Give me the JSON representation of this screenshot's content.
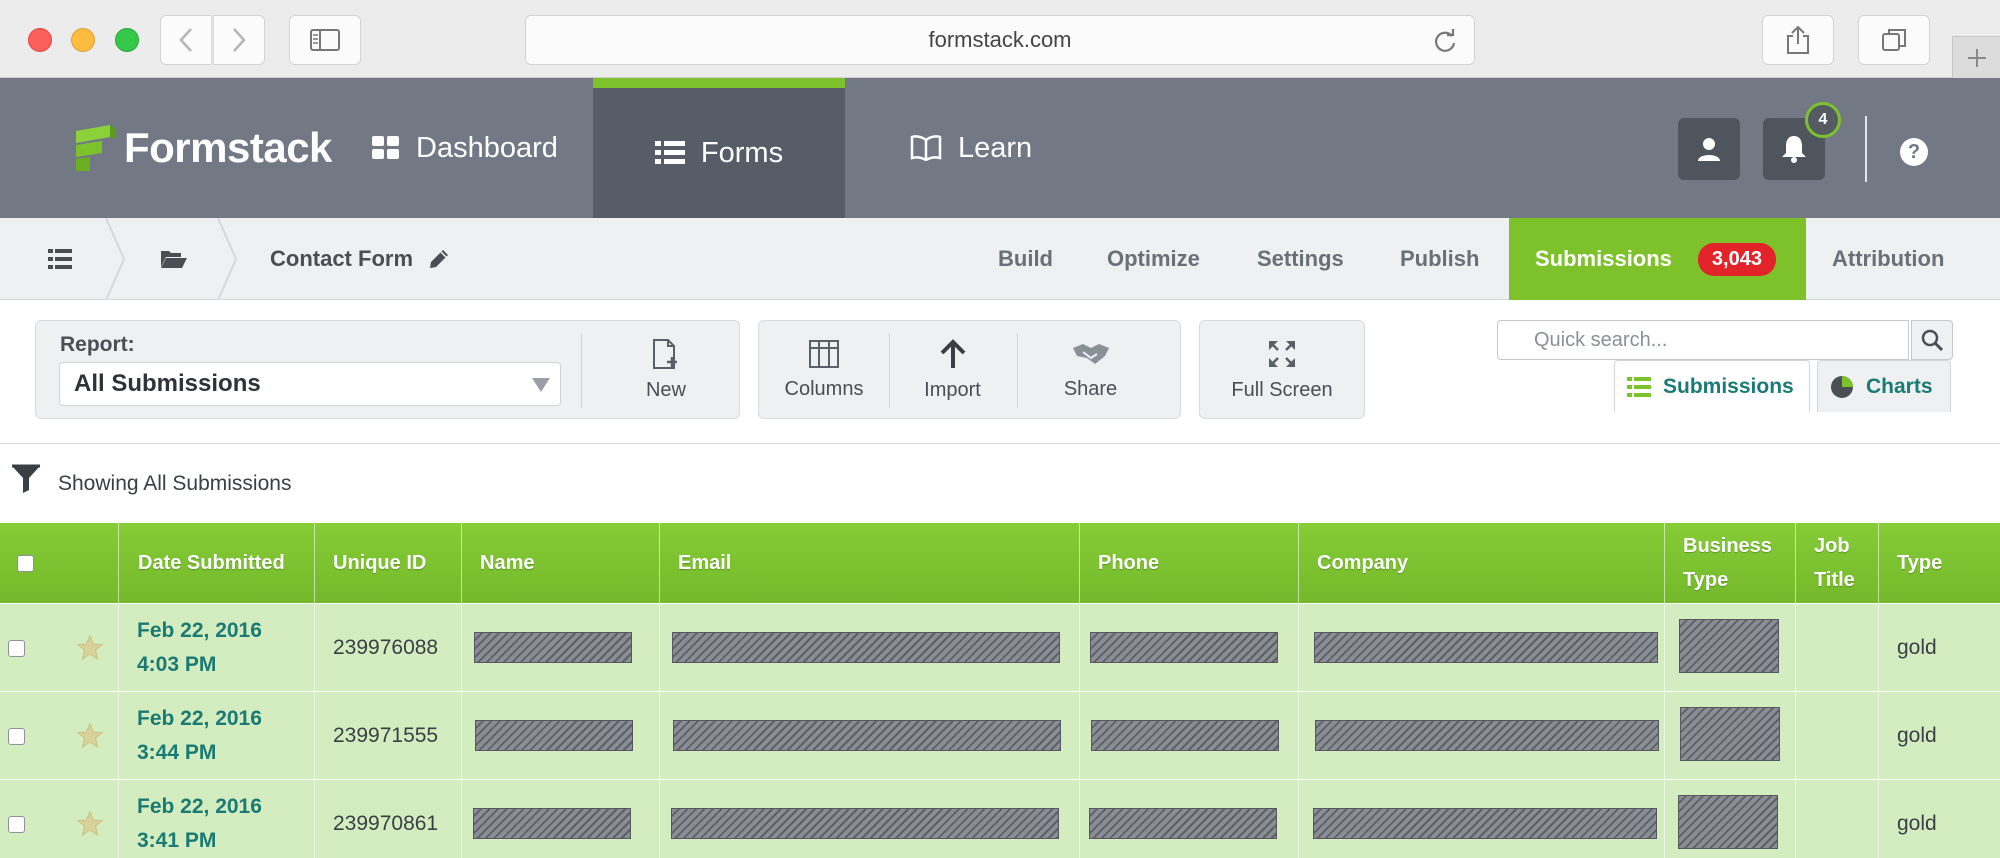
{
  "browser": {
    "url": "formstack.com"
  },
  "brand": {
    "name": "Formstack",
    "accent": "#7dc22b",
    "nav_bg": "#727985",
    "nav_active_bg": "#575d66",
    "teal_text": "#1a7a74",
    "badge_red": "#e2232a"
  },
  "nav": {
    "items": [
      {
        "label": "Dashboard",
        "icon": "dashboard-grid-icon"
      },
      {
        "label": "Forms",
        "icon": "list-icon",
        "active": true
      },
      {
        "label": "Learn",
        "icon": "book-icon"
      }
    ],
    "notifications_count": "4",
    "help": "?"
  },
  "subnav": {
    "form_title": "Contact Form",
    "tabs": [
      {
        "label": "Build"
      },
      {
        "label": "Optimize"
      },
      {
        "label": "Settings"
      },
      {
        "label": "Publish"
      },
      {
        "label": "Submissions",
        "active": true,
        "count": "3,043"
      },
      {
        "label": "Attribution"
      }
    ]
  },
  "toolbar": {
    "report_label": "Report:",
    "report_value": "All Submissions",
    "new_label": "New",
    "columns_label": "Columns",
    "import_label": "Import",
    "share_label": "Share",
    "fullscreen_label": "Full Screen",
    "search_placeholder": "Quick search...",
    "view_tabs": [
      {
        "label": "Submissions",
        "active": true
      },
      {
        "label": "Charts"
      }
    ]
  },
  "filter": {
    "text": "Showing All Submissions"
  },
  "table": {
    "headers": {
      "date": "Date Submitted",
      "unique_id": "Unique ID",
      "name": "Name",
      "email": "Email",
      "phone": "Phone",
      "company": "Company",
      "business_type": "Business Type",
      "job_title": "Job Title",
      "type": "Type"
    },
    "rows": [
      {
        "date": "Feb 22, 2016",
        "time": "4:03 PM",
        "id": "239976088",
        "type": "gold"
      },
      {
        "date": "Feb 22, 2016",
        "time": "3:44 PM",
        "id": "239971555",
        "type": "gold"
      },
      {
        "date": "Feb 22, 2016",
        "time": "3:41 PM",
        "id": "239970861",
        "type": "gold"
      }
    ]
  }
}
